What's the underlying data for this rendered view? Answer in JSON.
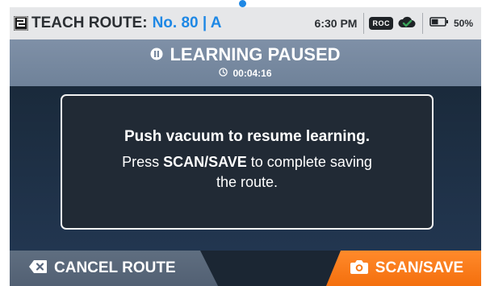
{
  "status_bar": {
    "title_prefix": "TEACH ROUTE:",
    "route_label": "No. 80 | A",
    "time": "6:30 PM",
    "roc_badge": "ROC",
    "battery_percent": 50,
    "battery_text": "50%",
    "route_icon": "route-icon",
    "cloud_icon": "cloud-check-icon",
    "battery_icon": "battery-icon"
  },
  "header": {
    "title": "LEARNING PAUSED",
    "timer": "00:04:16",
    "pause_icon": "pause-circle-icon",
    "clock_icon": "clock-icon"
  },
  "dialog": {
    "line1": "Push vacuum to resume learning.",
    "line2_pre": "Press ",
    "line2_bold": "SCAN/SAVE",
    "line2_post": " to complete saving the route."
  },
  "bottom_bar": {
    "cancel_label": "CANCEL ROUTE",
    "cancel_icon": "backspace-x-icon",
    "save_label": "SCAN/SAVE",
    "save_icon": "camera-icon"
  },
  "colors": {
    "accent_blue": "#1e88e5",
    "save_orange": "#f46f0d",
    "header_bg": "#7889a0",
    "cloud_green": "#3aa35a"
  }
}
